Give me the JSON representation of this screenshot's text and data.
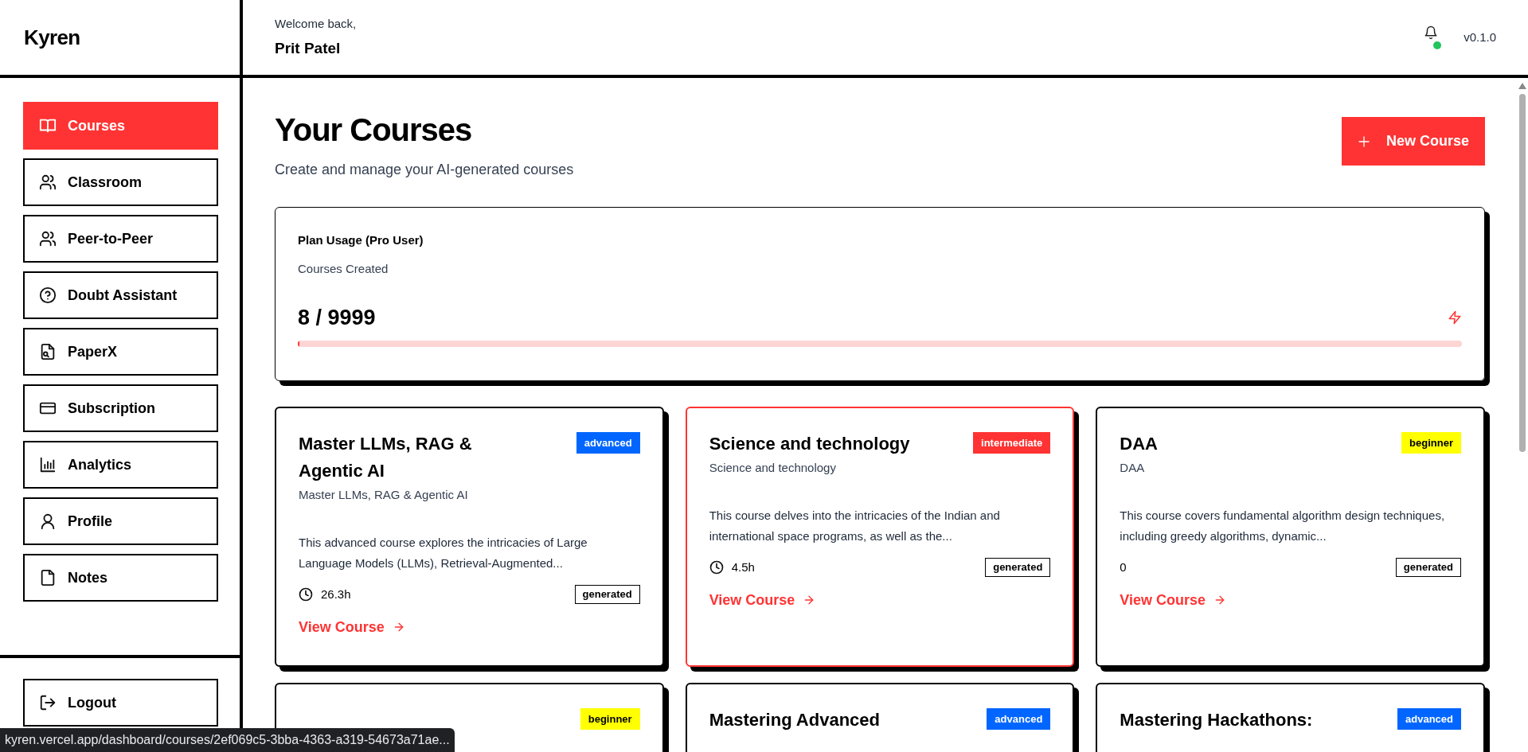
{
  "brand": {
    "name": "Kyren"
  },
  "sidebar": {
    "items": [
      {
        "label": "Courses",
        "kind": "book",
        "selected": true
      },
      {
        "label": "Classroom",
        "kind": "users",
        "selected": false
      },
      {
        "label": "Peer-to-Peer",
        "kind": "users",
        "selected": false
      },
      {
        "label": "Doubt Assistant",
        "kind": "help",
        "selected": false
      },
      {
        "label": "PaperX",
        "kind": "file",
        "selected": false
      },
      {
        "label": "Subscription",
        "kind": "card",
        "selected": false
      },
      {
        "label": "Analytics",
        "kind": "chart",
        "selected": false
      },
      {
        "label": "Profile",
        "kind": "user",
        "selected": false
      },
      {
        "label": "Notes",
        "kind": "note",
        "selected": false
      }
    ],
    "logout": {
      "label": "Logout"
    }
  },
  "header": {
    "greeting": "Welcome back,",
    "user_name": "Prit Patel",
    "notification_online": true,
    "version": "v0.1.0"
  },
  "page": {
    "title": "Your Courses",
    "subtitle": "Create and manage your AI-generated courses",
    "new_button": "New Course"
  },
  "plan_usage": {
    "title": "Plan Usage (Pro User)",
    "label": "Courses Created",
    "count": "8 / 9999",
    "level": 0.0008
  },
  "courses": [
    {
      "title": "Master LLMs, RAG & Agentic AI",
      "subtitle": "Master LLMs, RAG & Agentic AI",
      "level_badge": "advanced",
      "color": "#0066ff",
      "description": "This advanced course explores the intricacies of Large Language Models (LLMs), Retrieval-Augmented...",
      "duration": "26.3h",
      "has_clock": true,
      "tag": "generated",
      "link": "View Course",
      "highlighted": false
    },
    {
      "title": "Science and technology",
      "subtitle": "Science and technology",
      "level_badge": "intermediate",
      "color": "#ff3333",
      "description": "This course delves into the intricacies of the Indian and international space programs, as well as the...",
      "duration": "4.5h",
      "has_clock": true,
      "tag": "generated",
      "link": "View Course",
      "highlighted": true
    },
    {
      "title": "DAA",
      "subtitle": "DAA",
      "level_badge": "beginner",
      "color": "#ffff00",
      "description": "This course covers fundamental algorithm design techniques, including greedy algorithms, dynamic...",
      "duration": "0",
      "has_clock": false,
      "tag": "generated",
      "link": "View Course",
      "highlighted": false
    },
    {
      "level_badge": "beginner",
      "color": "#ffff00",
      "highlighted": false
    },
    {
      "title": "Mastering Advanced",
      "level_badge": "advanced",
      "color": "#0066ff",
      "highlighted": false
    },
    {
      "title": "Mastering Hackathons:",
      "level_badge": "advanced",
      "color": "#0066ff",
      "highlighted": false
    }
  ],
  "status_bar": {
    "url": "kyren.vercel.app/dashboard/courses/2ef069c5-3bba-4363-a319-54673a71ae..."
  }
}
